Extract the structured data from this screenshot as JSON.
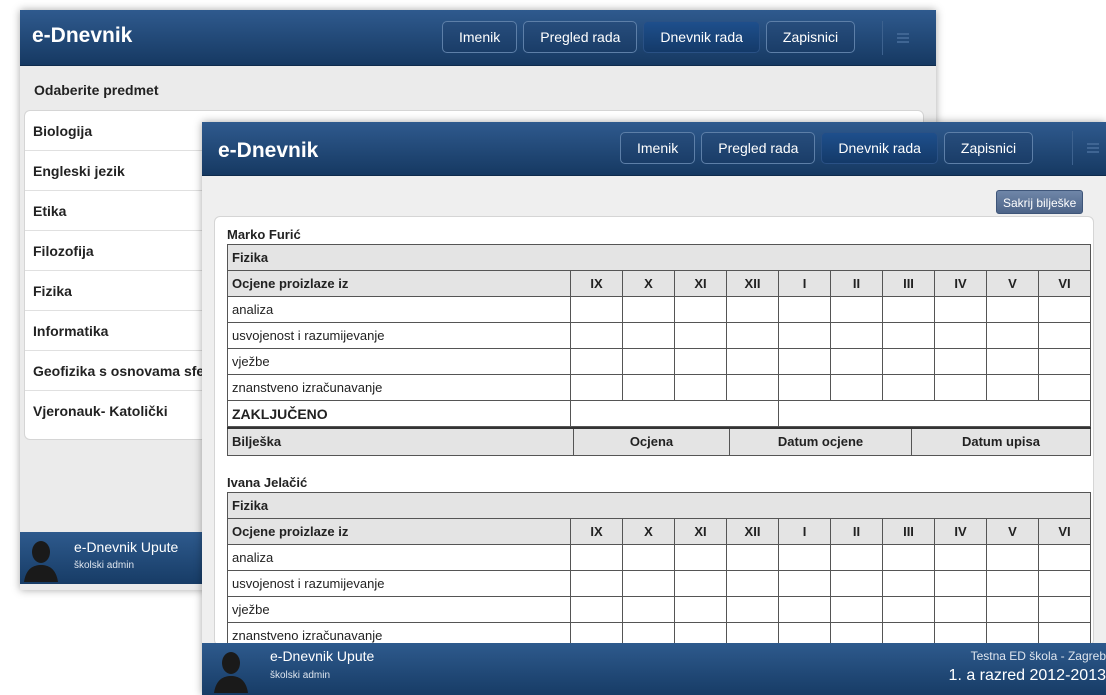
{
  "app": {
    "title": "e-Dnevnik"
  },
  "nav": [
    "Imenik",
    "Pregled rada",
    "Dnevnik rada",
    "Zapisnici"
  ],
  "back": {
    "heading": "Odaberite predmet",
    "subjects": [
      "Biologija",
      "Engleski jezik",
      "Etika",
      "Filozofija",
      "Fizika",
      "Informatika",
      "Geofizika s osnovama sfe",
      "Vjeronauk- Katolički"
    ],
    "footer": {
      "name": "e-Dnevnik Upute",
      "role": "školski admin"
    }
  },
  "front": {
    "hide_notes_label": "Sakrij bilješke",
    "months": [
      "IX",
      "X",
      "XI",
      "XII",
      "I",
      "II",
      "III",
      "IV",
      "V",
      "VI"
    ],
    "grades_header": "Ocjene proizlaze iz",
    "subject": "Fizika",
    "components": [
      "analiza",
      "usvojenost i razumijevanje",
      "vježbe",
      "znanstveno izračunavanje"
    ],
    "final_label": "ZAKLJUČENO",
    "notes_header": {
      "note": "Bilješka",
      "grade": "Ocjena",
      "grade_date": "Datum ocjene",
      "entry_date": "Datum upisa"
    },
    "students": [
      "Marko Furić",
      "Ivana Jelačić"
    ],
    "footer": {
      "name": "e-Dnevnik Upute",
      "role": "školski admin",
      "school": "Testna ED škola - Zagreb",
      "grade": "1. a razred 2012-2013"
    }
  },
  "colors": {
    "header": "#1f4573",
    "accent": "#5c7399"
  }
}
